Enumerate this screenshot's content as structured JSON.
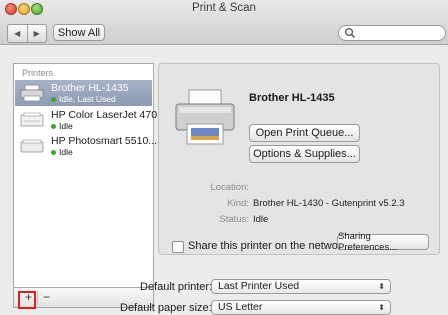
{
  "window": {
    "title": "Print & Scan"
  },
  "toolbar": {
    "back_icon": "◀",
    "forward_icon": "▶",
    "show_all": "Show All",
    "search_placeholder": ""
  },
  "printers": {
    "header": "Printers",
    "items": [
      {
        "name": "Brother HL-1435",
        "status": "Idle, Last Used",
        "selected": true
      },
      {
        "name": "HP Color LaserJet 470...",
        "status": "Idle",
        "selected": false
      },
      {
        "name": "HP Photosmart 5510...",
        "status": "Idle",
        "selected": false
      }
    ],
    "add_label": "+",
    "remove_label": "−"
  },
  "details": {
    "title": "Brother HL-1435",
    "open_queue": "Open Print Queue...",
    "options_supplies": "Options & Supplies...",
    "location_label": "Location:",
    "location_value": "",
    "kind_label": "Kind:",
    "kind_value": "Brother HL-1430 - Gutenprint v5.2.3",
    "status_label": "Status:",
    "status_value": "Idle",
    "share_label": "Share this printer on the network",
    "sharing_prefs": "Sharing Preferences..."
  },
  "defaults": {
    "printer_label": "Default printer:",
    "printer_value": "Last Printer Used",
    "paper_label": "Default paper size:",
    "paper_value": "US Letter"
  },
  "colors": {
    "selection": "#8d9bb3",
    "highlight_box": "#d81e1e"
  }
}
